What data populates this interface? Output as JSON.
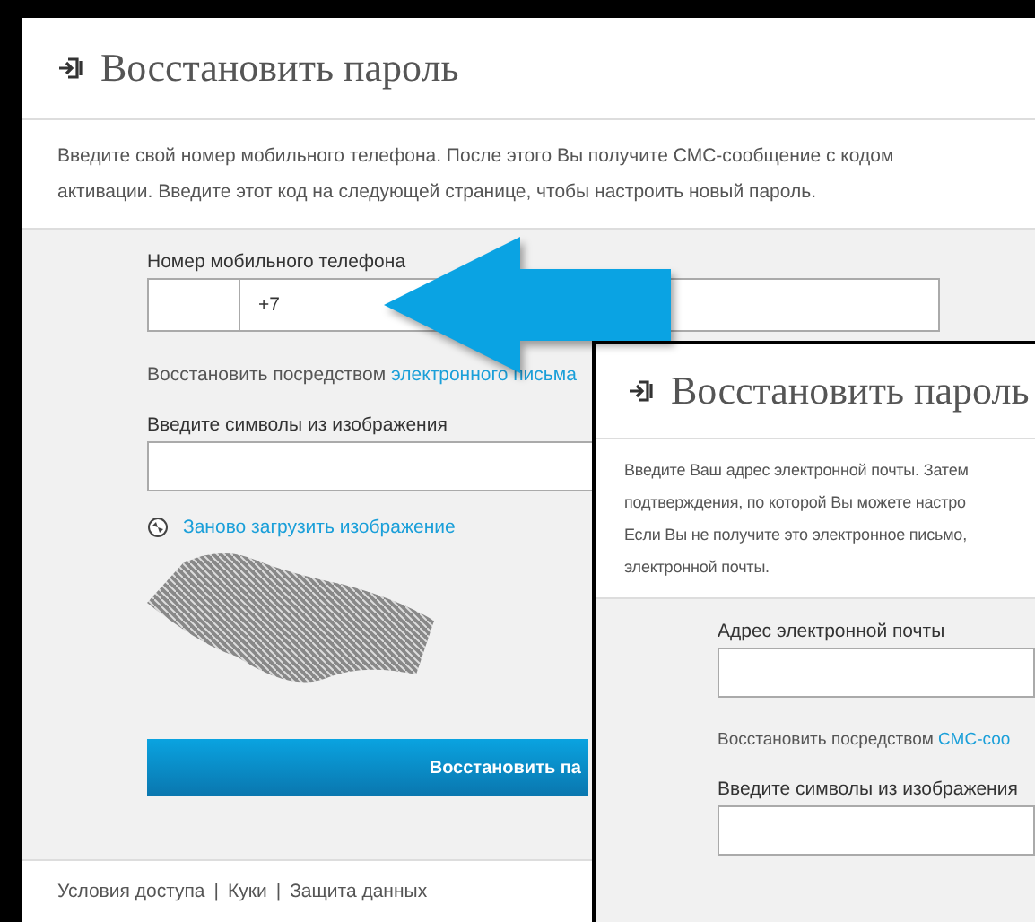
{
  "main_page": {
    "title": "Восстановить пароль",
    "description": "Введите свой номер мобильного телефона. После этого Вы получите СМС-сообщение с кодом активации. Введите этот код на следующей странице, чтобы настроить новый пароль.",
    "phone_label": "Номер мобильного телефона",
    "phone_value": "+7",
    "alt_prefix": "Восстановить посредством",
    "alt_link": "электронного письма",
    "captcha_label": "Введите символы из изображения",
    "reload_link": "Заново загрузить изображение",
    "submit_button": "Восстановить па",
    "footer_links": [
      {
        "label": "Условия доступа"
      },
      {
        "label": "Куки"
      },
      {
        "label": "Защита данных"
      }
    ],
    "footer_separator": "|"
  },
  "overlay_page": {
    "title": "Восстановить пароль",
    "description_lines": [
      "Введите Ваш адрес электронной почты. Затем",
      "подтверждения, по которой Вы можете настро",
      "Если Вы не получите это электронное письмо,",
      "электронной почты."
    ],
    "email_label": "Адрес электронной почты",
    "alt_prefix": "Восстановить посредством",
    "alt_link": "СМС-соо",
    "captcha_label": "Введите символы из изображения"
  }
}
